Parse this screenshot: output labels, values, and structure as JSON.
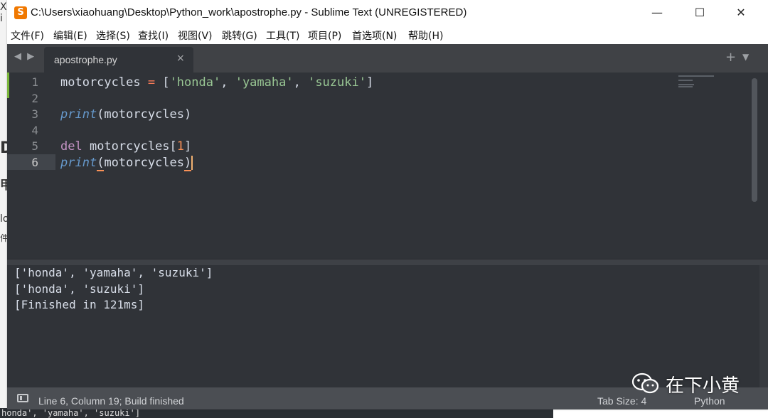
{
  "window": {
    "title": "C:\\Users\\xiaohuang\\Desktop\\Python_work\\apostrophe.py - Sublime Text (UNREGISTERED)",
    "app_icon": "sublime-icon",
    "controls": {
      "minimize": "—",
      "maximize": "☐",
      "close": "✕"
    }
  },
  "menu": [
    "文件(F)",
    "编辑(E)",
    "选择(S)",
    "查找(I)",
    "视图(V)",
    "跳转(G)",
    "工具(T)",
    "项目(P)",
    "首选项(N)",
    "帮助(H)"
  ],
  "tabs": {
    "nav": "◀ ▶",
    "active": {
      "label": "apostrophe.py",
      "close": "×"
    },
    "plus": "+",
    "menu": "▼"
  },
  "editor": {
    "line_numbers": [
      "1",
      "2",
      "3",
      "4",
      "5",
      "6"
    ],
    "current_line": "6",
    "code": {
      "l1": {
        "var": "motorcycles ",
        "op": "=",
        "open": " [",
        "s1": "'honda'",
        "c1": ", ",
        "s2": "'yamaha'",
        "c2": ", ",
        "s3": "'suzuki'",
        "close": "]"
      },
      "l3": {
        "fn": "print",
        "args": "(motorcycles)"
      },
      "l5": {
        "kw": "del",
        "rest": " motorcycles[",
        "num": "1",
        "close": "]"
      },
      "l6": {
        "fn": "print",
        "open": "(",
        "args": "motorcycles",
        "close": ")"
      }
    }
  },
  "output": {
    "lines": [
      "['honda', 'yamaha', 'suzuki']",
      "['honda', 'suzuki']",
      "[Finished in 121ms]"
    ]
  },
  "status": {
    "left": "Line 6, Column 19; Build finished",
    "tab_size": "Tab Size: 4",
    "syntax": "Python"
  },
  "watermark": {
    "text": "在下小黄",
    "icon": "wechat-icon"
  },
  "background": {
    "left_glyphs": [
      "X",
      "i",
      "",
      "D",
      "5",
      "甲",
      "",
      "lo",
      "件"
    ],
    "bottom_text": "honda', 'yamaha', 'suzuki']"
  },
  "colors": {
    "editor_bg": "#303338",
    "string": "#99c794",
    "operator": "#f97b58",
    "number": "#f99157",
    "function": "#6699cc",
    "keyword": "#c594c5",
    "text": "#d8dee9"
  }
}
